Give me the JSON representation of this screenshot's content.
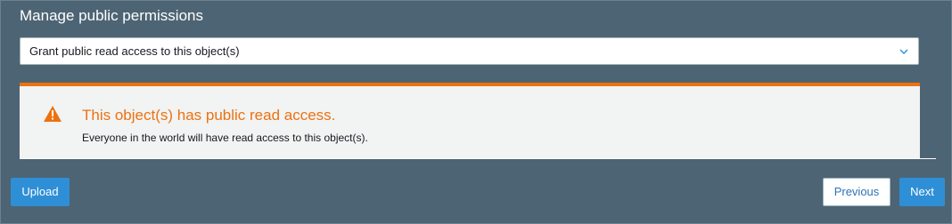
{
  "section": {
    "title": "Manage public permissions"
  },
  "permission_select": {
    "selected": "Grant public read access to this object(s)",
    "icon": "chevron-down-icon"
  },
  "alert": {
    "icon": "warning-icon",
    "title": "This object(s) has public read access.",
    "message": "Everyone in the world will have read access to this object(s).",
    "accent_color": "#ec7211"
  },
  "footer": {
    "upload_label": "Upload",
    "previous_label": "Previous",
    "next_label": "Next"
  },
  "colors": {
    "panel_bg": "#4d6474",
    "primary": "#2e8fd6",
    "warning": "#ec7211"
  }
}
